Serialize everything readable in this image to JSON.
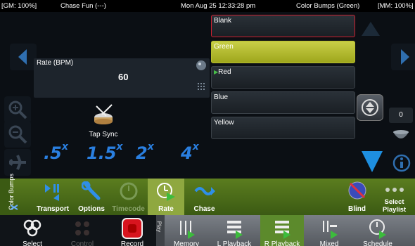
{
  "status_bar": {
    "gm": "[GM: 100%]",
    "chase": "Chase Fun (---)",
    "datetime": "Mon Aug 25 12:33:28 pm",
    "current_cue": "Color Bumps (Green)",
    "mm": "[MM: 100%]"
  },
  "rate": {
    "label": "Rate (BPM)",
    "value": "60",
    "tap_label": "Tap Sync",
    "multipliers": [
      {
        "base": ".5",
        "sup": "x"
      },
      {
        "base": "1.5",
        "sup": "x"
      },
      {
        "base": "2",
        "sup": "x"
      },
      {
        "base": "4",
        "sup": "x"
      }
    ]
  },
  "cues": [
    {
      "label": "Blank"
    },
    {
      "label": "Green"
    },
    {
      "label": "Red"
    },
    {
      "label": "Blue"
    },
    {
      "label": "Yellow"
    }
  ],
  "count_value": "0",
  "toolbar": {
    "side_label": "Color Bumps",
    "items": [
      {
        "label": "Transport"
      },
      {
        "label": "Options"
      },
      {
        "label": "Timecode"
      },
      {
        "label": "Rate"
      },
      {
        "label": "Chase"
      },
      {
        "label": "Blind"
      },
      {
        "label": "Select Playlist"
      }
    ]
  },
  "dock": {
    "play_tab": "Play",
    "left": [
      {
        "label": "Select"
      },
      {
        "label": "Control"
      },
      {
        "label": "Record"
      }
    ],
    "right": [
      {
        "label": "Memory"
      },
      {
        "label": "L Playback"
      },
      {
        "label": "R Playback"
      },
      {
        "label": "Mixed"
      },
      {
        "label": "Schedule"
      }
    ]
  },
  "colors": {
    "accent_blue": "#2a7fe0",
    "active_cue": "#b7bf2f",
    "toolbar_green": "#4a6b18",
    "record_red": "#d8141e"
  }
}
